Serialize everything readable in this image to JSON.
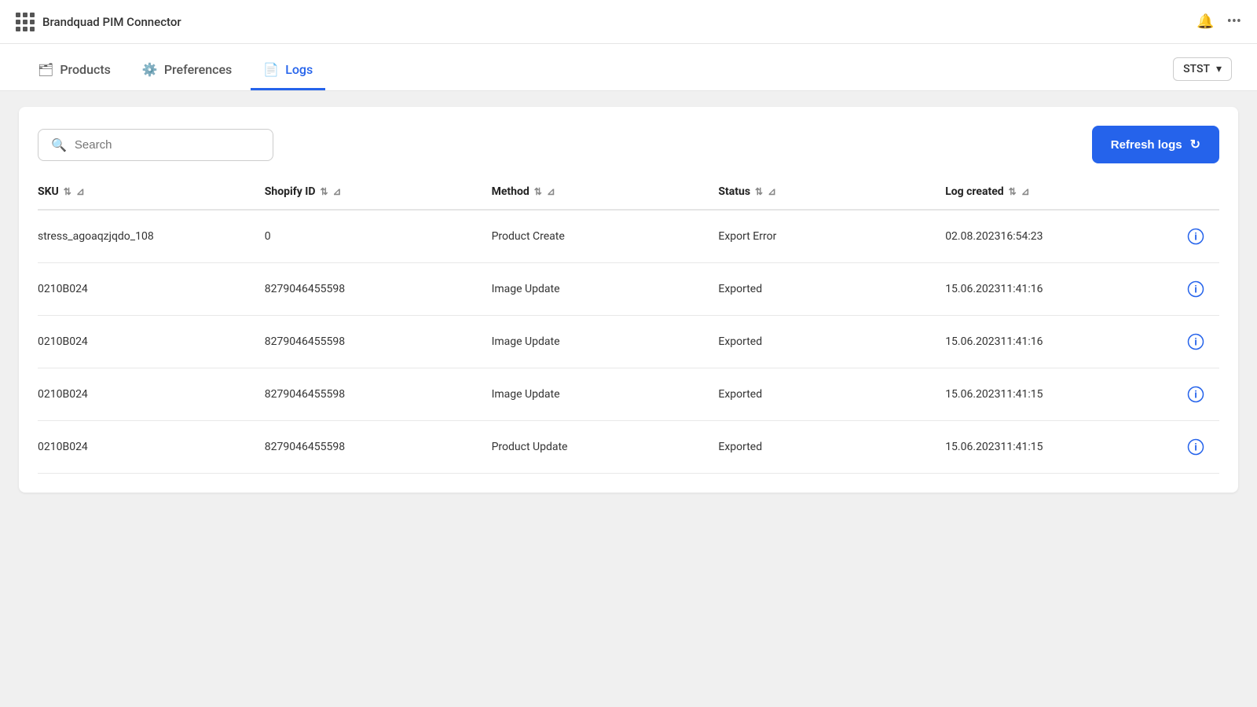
{
  "topbar": {
    "title": "Brandquad PIM Connector",
    "bell_icon": "bell-icon",
    "dots_icon": "more-dots-icon"
  },
  "nav": {
    "tabs": [
      {
        "id": "products",
        "label": "Products",
        "icon": "briefcase-icon",
        "active": false
      },
      {
        "id": "preferences",
        "label": "Preferences",
        "icon": "gear-icon",
        "active": false
      },
      {
        "id": "logs",
        "label": "Logs",
        "icon": "file-icon",
        "active": true
      }
    ],
    "dropdown": {
      "value": "STST",
      "label": "STST"
    }
  },
  "toolbar": {
    "search_placeholder": "Search",
    "refresh_label": "Refresh logs"
  },
  "table": {
    "columns": [
      {
        "id": "sku",
        "label": "SKU"
      },
      {
        "id": "shopify_id",
        "label": "Shopify ID"
      },
      {
        "id": "method",
        "label": "Method"
      },
      {
        "id": "status",
        "label": "Status"
      },
      {
        "id": "log_created",
        "label": "Log created"
      },
      {
        "id": "action",
        "label": ""
      }
    ],
    "rows": [
      {
        "sku": "stress_agoaqzjqdo_108",
        "shopify_id": "0",
        "method": "Product Create",
        "status": "Export Error",
        "log_created": "02.08.202316:54:23"
      },
      {
        "sku": "0210B024",
        "shopify_id": "8279046455598",
        "method": "Image Update",
        "status": "Exported",
        "log_created": "15.06.202311:41:16"
      },
      {
        "sku": "0210B024",
        "shopify_id": "8279046455598",
        "method": "Image Update",
        "status": "Exported",
        "log_created": "15.06.202311:41:16"
      },
      {
        "sku": "0210B024",
        "shopify_id": "8279046455598",
        "method": "Image Update",
        "status": "Exported",
        "log_created": "15.06.202311:41:15"
      },
      {
        "sku": "0210B024",
        "shopify_id": "8279046455598",
        "method": "Product Update",
        "status": "Exported",
        "log_created": "15.06.202311:41:15"
      }
    ]
  }
}
